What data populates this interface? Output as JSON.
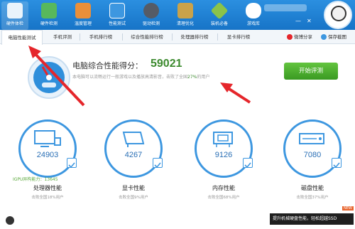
{
  "toolbar": {
    "items": [
      {
        "label": "硬件体检",
        "color": "#e9f3fb"
      },
      {
        "label": "硬件检测",
        "color": "#58b85c"
      },
      {
        "label": "温度管理",
        "color": "#e98f3a"
      },
      {
        "label": "性能测试",
        "color": "#3d97e0"
      },
      {
        "label": "驱动检测",
        "color": "#555b66"
      },
      {
        "label": "清理优化",
        "color": "#c9a24a"
      },
      {
        "label": "装机必备",
        "color": "#8bc34a"
      },
      {
        "label": "游戏库",
        "color": "#ffffff"
      }
    ]
  },
  "tabs": [
    "电脑性能测试",
    "手机评测",
    "手机排行榜",
    "综合性能排行榜",
    "处理器排行榜",
    "显卡排行榜"
  ],
  "share": {
    "weibo": "微博分享",
    "save": "保存截图"
  },
  "score": {
    "title": "电脑综合性能得分：",
    "value": "59021",
    "desc_before": "本电脑可以流畅运行一般游戏以及播放高清影音，击败了全国",
    "percent": "27%",
    "desc_after": "的用户"
  },
  "start_button": "开始评测",
  "cards": [
    {
      "value": "24903",
      "name": "处理器性能",
      "sub": "击败全国18%用户"
    },
    {
      "value": "4267",
      "name": "显卡性能",
      "sub": "击败全国9%用户"
    },
    {
      "value": "9126",
      "name": "内存性能",
      "sub": "击败全国68%用户"
    },
    {
      "value": "7080",
      "name": "磁盘性能",
      "sub": "击败全国37%用户"
    }
  ],
  "igpu": "IGPU异构能力：13645",
  "ad": {
    "text": "提升机械硬盘性能，轻松超越SSD",
    "badge": "NEW"
  },
  "colors": {
    "accent": "#1774c7",
    "score_green": "#3c8a2e",
    "annotation_red": "#e5262b"
  }
}
